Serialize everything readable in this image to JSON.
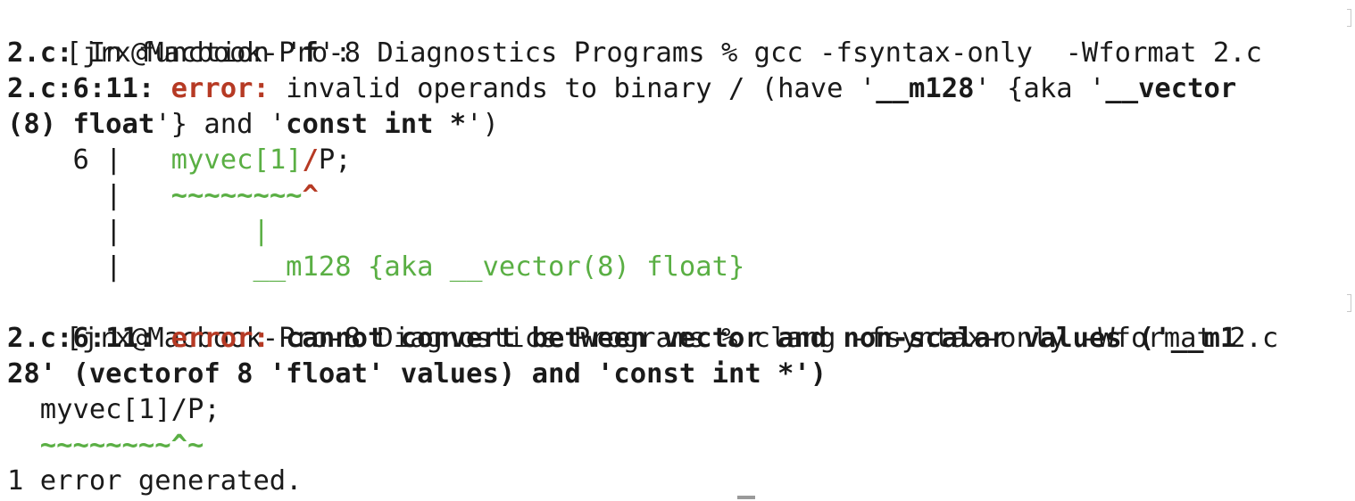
{
  "terminal": {
    "gcc_prompt": "[jrx@Macbook-Pro-8 Diagnostics Programs % gcc -fsyntax-only  -Wformat 2.c",
    "gcc_infunc": {
      "file": "2.c:",
      "text": " In function '",
      "name": "f",
      "end": "':"
    },
    "gcc_error": {
      "loc": "2.c:6:11:",
      "kw": "error:",
      "t1": " invalid operands to binary / (have '",
      "b1": "__m128",
      "t2": "' {aka '",
      "b2": "__vector"
    },
    "gcc_error_cont": {
      "b1": "(8) float",
      "t1": "'} and '",
      "b2": "const int *",
      "t2": "')"
    },
    "gcc_src": {
      "lineno": "    6 |   ",
      "lhs": "myvec[1]",
      "op": "/",
      "rhs": "P;"
    },
    "gcc_caret": {
      "bar": "      |   ",
      "tildes": "~~~~~~~~",
      "caret": "^"
    },
    "gcc_pipe": {
      "bar": "      |        ",
      "mark": "|"
    },
    "gcc_label": {
      "bar": "      |        ",
      "text": "__m128 {aka __vector(8) float}"
    },
    "clang_prompt": "[jrx@Macbook-Pro-8 Diagnostics Programs % clang -fsyntax-only -Wformat 2.c",
    "clang_error": {
      "loc": "2.c:6:11:",
      "kw": "error:",
      "msg": " cannot convert between vector and non-scalar values ('__m1"
    },
    "clang_error_cont": "28' (vectorof 8 'float' values) and 'const int *')",
    "clang_src": "  myvec[1]/P;",
    "clang_caret": "  ~~~~~~~~^~",
    "summary": "1 error generated."
  }
}
